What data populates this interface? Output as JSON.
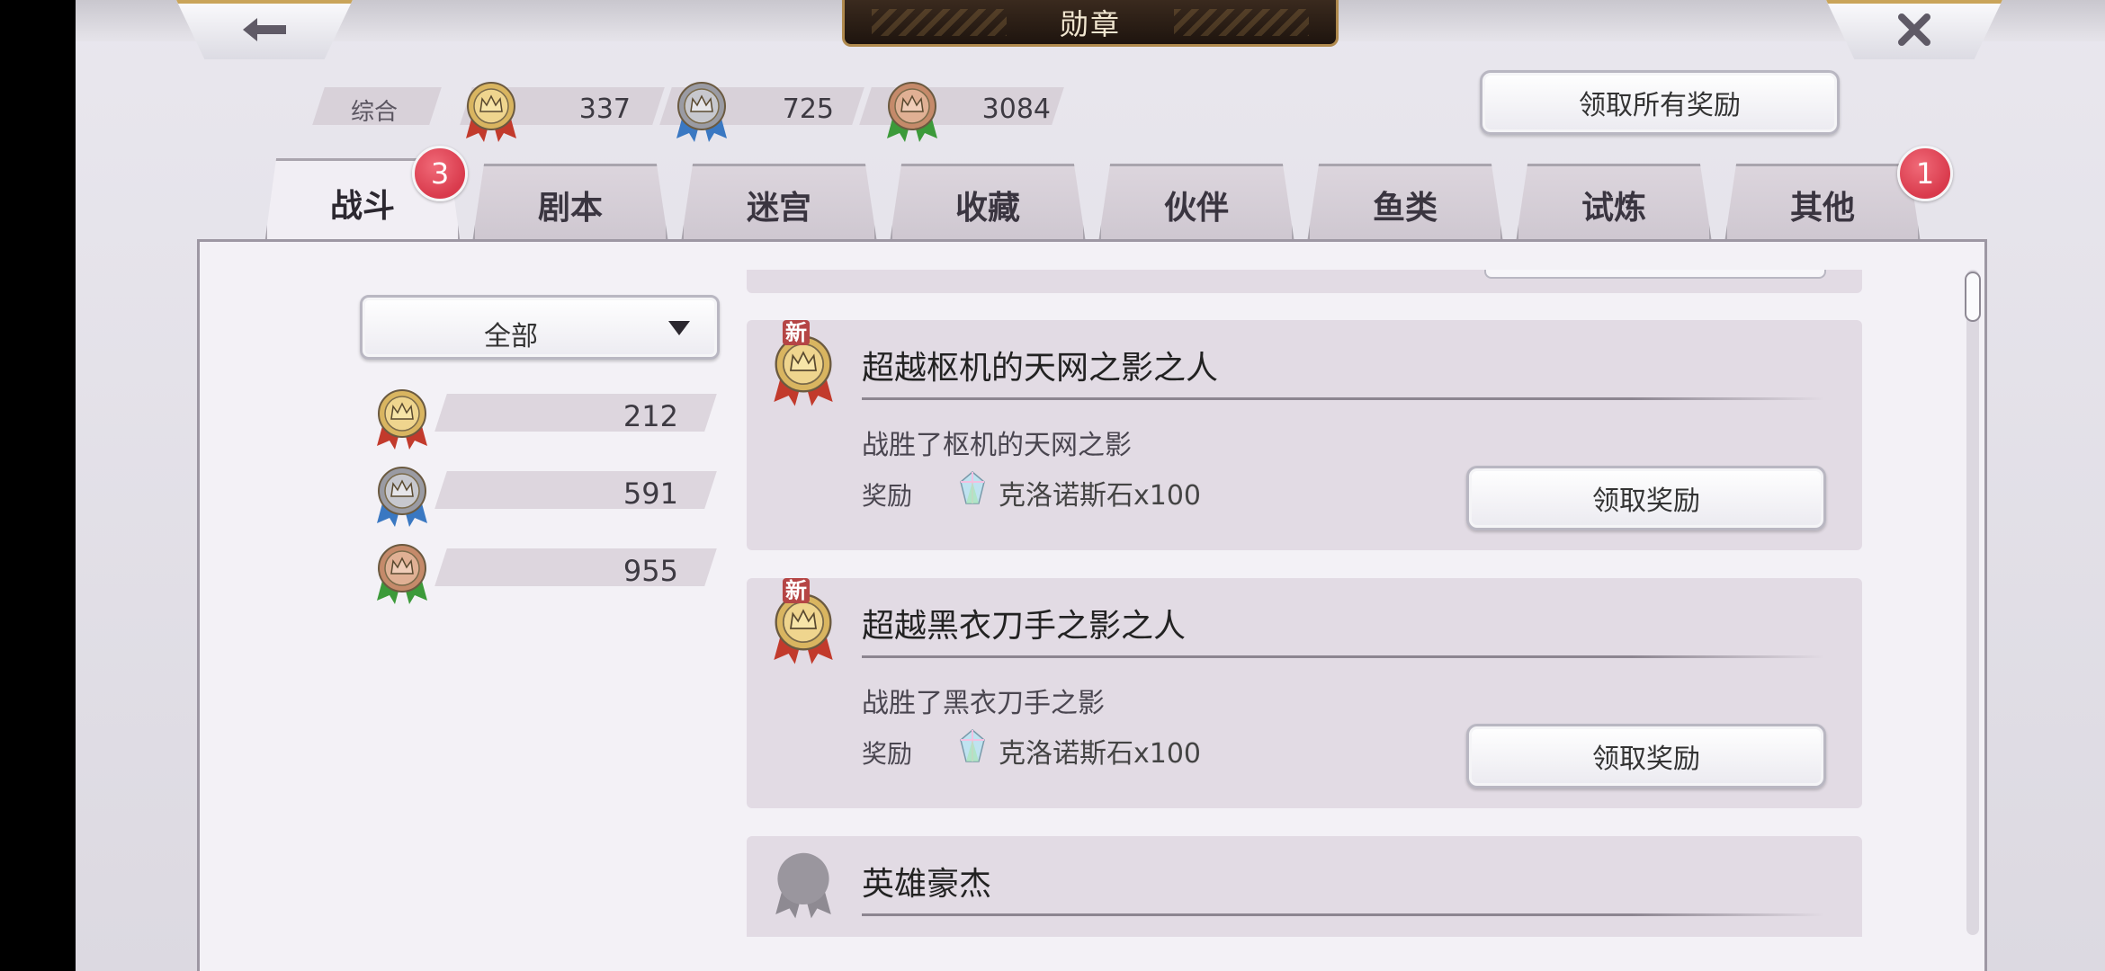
{
  "header": {
    "title": "勋章",
    "back_icon": "arrow-left-icon",
    "close_icon": "close-x-icon"
  },
  "summary": {
    "label": "综合",
    "gold_count": "337",
    "silver_count": "725",
    "bronze_count": "3084",
    "claim_all_label": "领取所有奖励"
  },
  "tabs": [
    {
      "label": "战斗",
      "active": true,
      "badge": "3"
    },
    {
      "label": "剧本"
    },
    {
      "label": "迷宫"
    },
    {
      "label": "收藏"
    },
    {
      "label": "伙伴"
    },
    {
      "label": "鱼类"
    },
    {
      "label": "试炼"
    },
    {
      "label": "其他",
      "badge": "1"
    }
  ],
  "filter": {
    "selected": "全部",
    "counts": {
      "gold": "212",
      "silver": "591",
      "bronze": "955"
    }
  },
  "list": [
    {
      "new_tag": "新",
      "title": "超越枢机的天网之影之人",
      "description": "战胜了枢机的天网之影",
      "reward_label": "奖励",
      "reward_text": "克洛诺斯石x100",
      "claim_label": "领取奖励"
    },
    {
      "new_tag": "新",
      "title": "超越黑衣刀手之影之人",
      "description": "战胜了黑衣刀手之影",
      "reward_label": "奖励",
      "reward_text": "克洛诺斯石x100",
      "claim_label": "领取奖励"
    },
    {
      "title": "英雄豪杰"
    }
  ],
  "colors": {
    "gold_medal": "#d9b560",
    "silver_medal": "#a9aab2",
    "bronze_medal": "#c58a6a",
    "badge_red": "#d93a4c",
    "ribbon_red": "#c23a2c",
    "ribbon_blue": "#3a78c2",
    "ribbon_green": "#3c9a3a"
  }
}
